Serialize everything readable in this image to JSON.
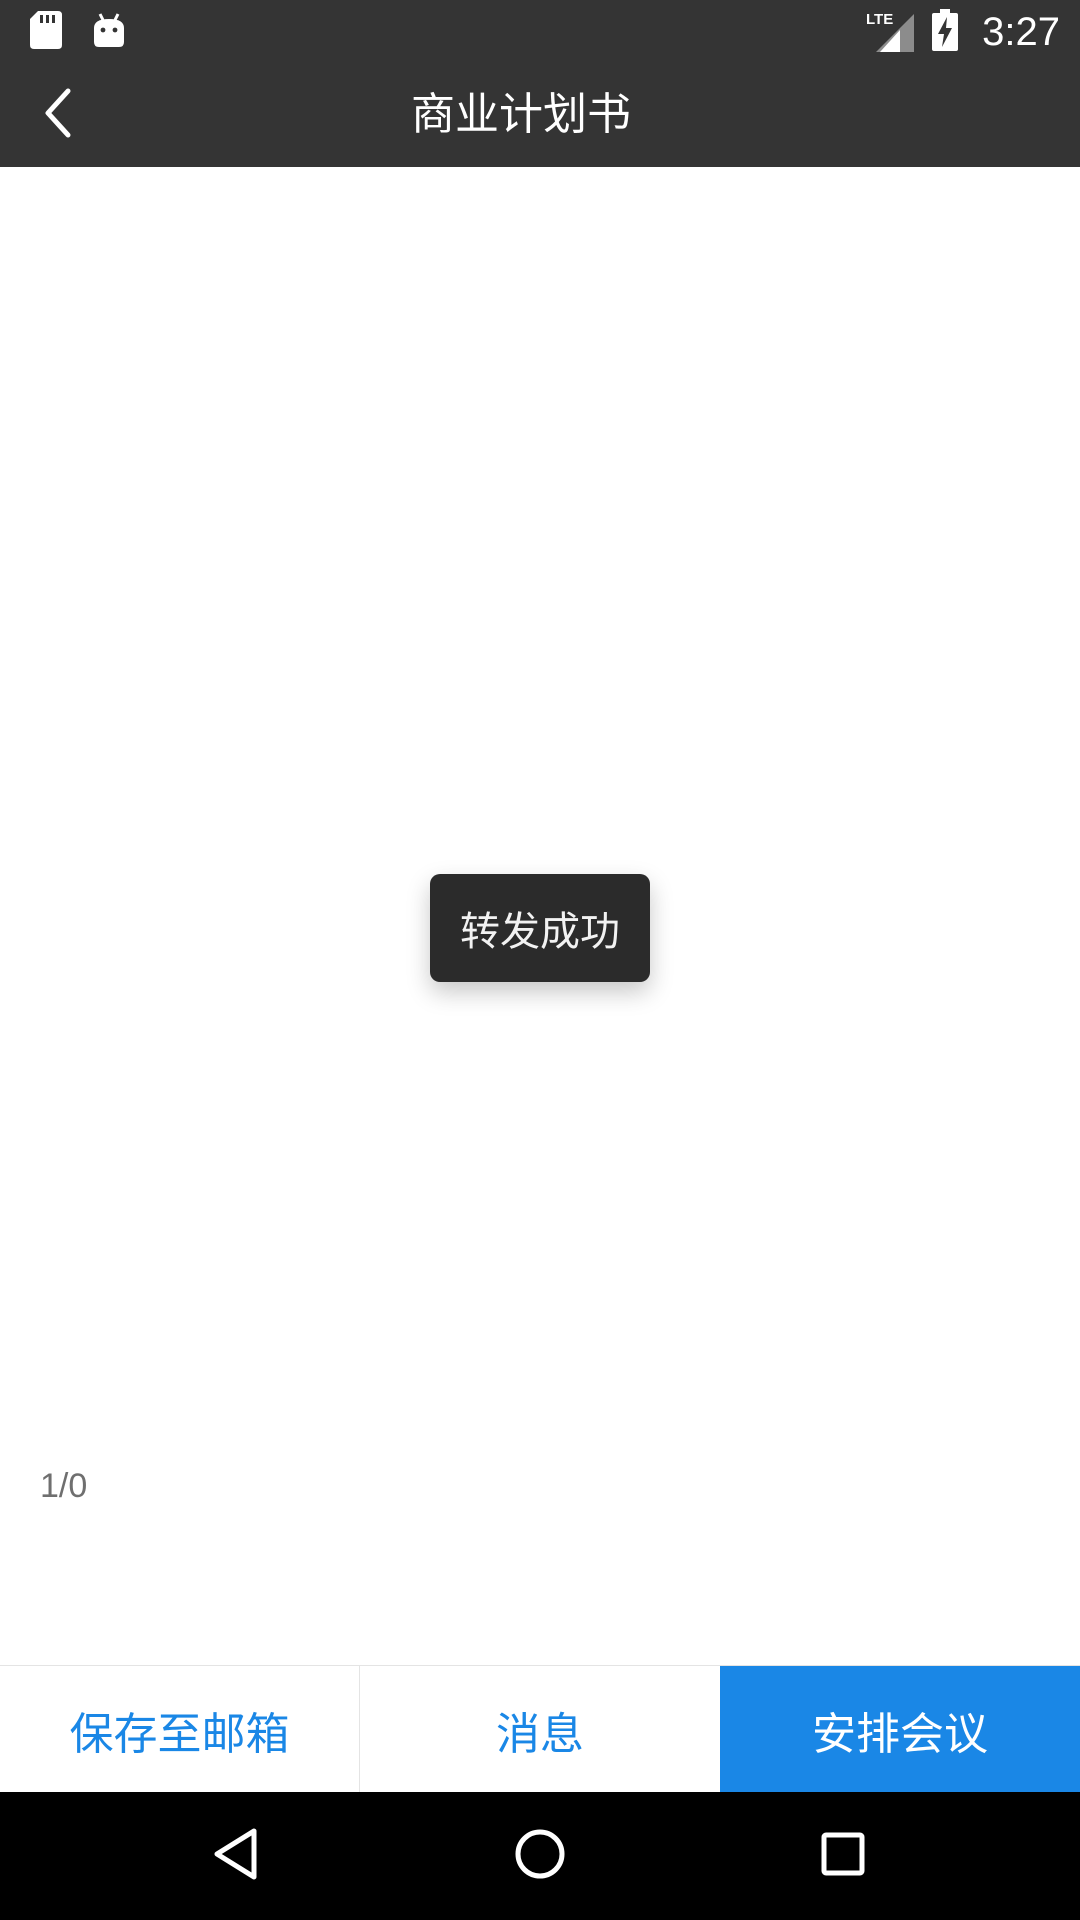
{
  "status_bar": {
    "left_icons": [
      "sd-card-icon",
      "android-debug-icon"
    ],
    "right_icons": [
      "lte-signal-icon",
      "battery-charging-icon"
    ],
    "network_label": "LTE",
    "time": "3:27"
  },
  "toolbar": {
    "back_icon": "chevron-left-icon",
    "title": "商业计划书"
  },
  "document": {
    "page_indicator": "1/0"
  },
  "toast": {
    "message": "转发成功"
  },
  "actions": {
    "save_to_mail": "保存至邮箱",
    "message": "消息",
    "schedule_meeting": "安排会议"
  },
  "colors": {
    "toolbar_bg": "#343434",
    "accent": "#1a87e6",
    "toast_bg": "#2b2b2b",
    "nav_bg": "#000000"
  },
  "nav_bar": {
    "icons": [
      "back-triangle-icon",
      "home-circle-icon",
      "recents-square-icon"
    ]
  }
}
